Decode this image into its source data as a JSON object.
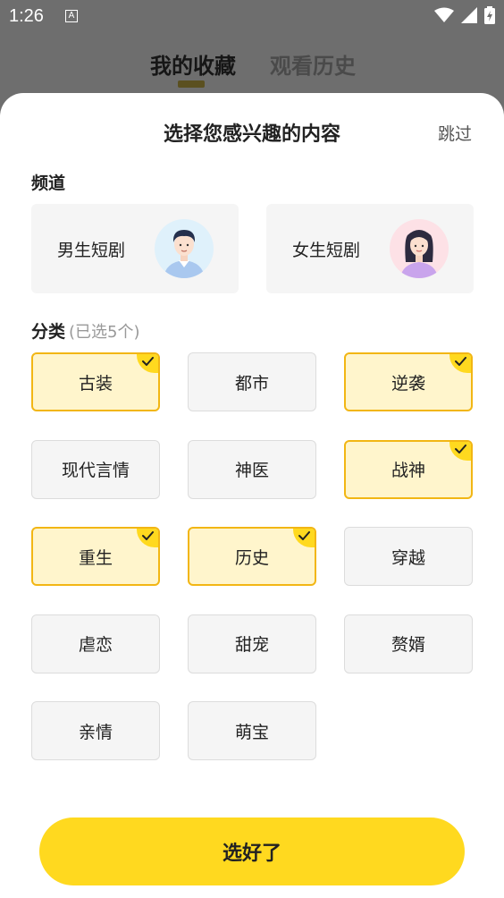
{
  "status": {
    "time": "1:26",
    "app_icon_letter": "A"
  },
  "top_tabs": [
    {
      "label": "我的收藏"
    },
    {
      "label": "观看历史"
    }
  ],
  "sheet": {
    "title": "选择您感兴趣的内容",
    "skip": "跳过",
    "channel_section": "频道",
    "channels": [
      {
        "label": "男生短剧",
        "icon": "male-avatar-icon"
      },
      {
        "label": "女生短剧",
        "icon": "female-avatar-icon"
      }
    ],
    "category_section": "分类",
    "category_note": "(已选5个)",
    "categories": [
      {
        "label": "古装",
        "selected": true
      },
      {
        "label": "都市",
        "selected": false
      },
      {
        "label": "逆袭",
        "selected": true
      },
      {
        "label": "现代言情",
        "selected": false
      },
      {
        "label": "神医",
        "selected": false
      },
      {
        "label": "战神",
        "selected": true
      },
      {
        "label": "重生",
        "selected": true
      },
      {
        "label": "历史",
        "selected": true
      },
      {
        "label": "穿越",
        "selected": false
      },
      {
        "label": "虐恋",
        "selected": false
      },
      {
        "label": "甜宠",
        "selected": false
      },
      {
        "label": "赘婿",
        "selected": false
      },
      {
        "label": "亲情",
        "selected": false
      },
      {
        "label": "萌宝",
        "selected": false
      }
    ],
    "confirm": "选好了"
  },
  "colors": {
    "accent": "#ffd91f",
    "selected_bg": "#fff5cc",
    "selected_border": "#f2b614"
  }
}
